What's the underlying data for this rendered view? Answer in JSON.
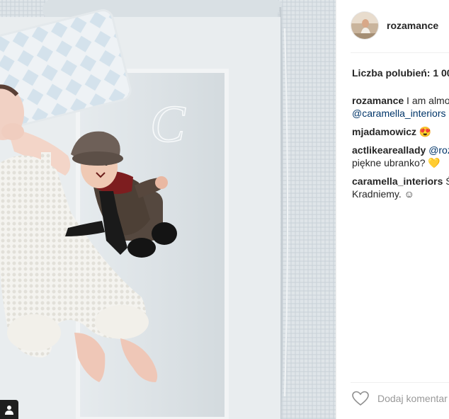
{
  "post": {
    "username": "rozamance",
    "likes_label": "Liczba polubień: 1 00",
    "add_comment_placeholder": "Dodaj komentar"
  },
  "comments": [
    {
      "user": "rozamance",
      "text_before": " I am almo",
      "mention": "@caramella_interiors",
      "text_after": ""
    },
    {
      "user": "mjadamowicz",
      "text_before": " 😍",
      "mention": "",
      "text_after": ""
    },
    {
      "user": "actlikeareallady",
      "text_before": " ",
      "mention": "@roz",
      "text_after": "piękne ubranko? 💛"
    },
    {
      "user": "caramella_interiors",
      "text_before": " Ś",
      "mention": "",
      "text_after": "Kradniemy. ☺"
    }
  ],
  "photo": {
    "monogram": "C"
  },
  "icons": {
    "user_tag": "person-icon",
    "like": "heart-icon"
  }
}
